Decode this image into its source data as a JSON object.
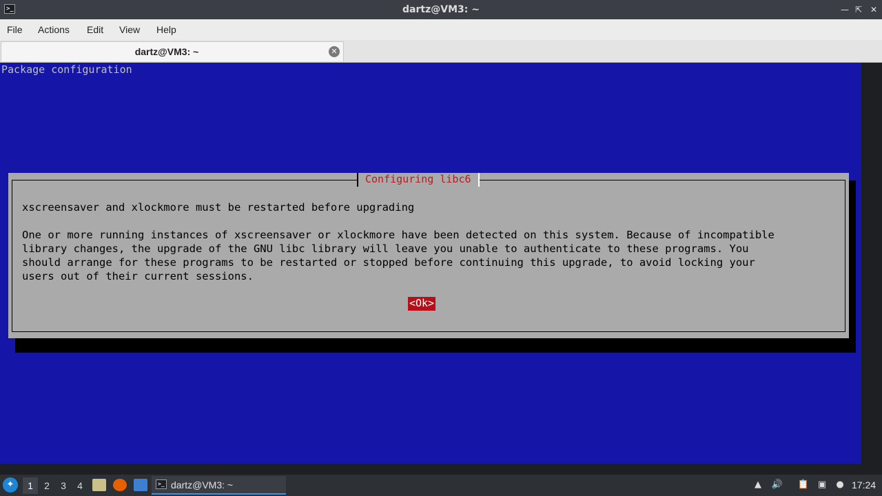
{
  "window": {
    "title": "dartz@VM3: ~",
    "app_icon": "terminal-icon",
    "controls": {
      "minimize": "minimize-icon",
      "restore": "restore-icon",
      "close": "close-icon"
    }
  },
  "menubar": {
    "items": [
      {
        "label": "File"
      },
      {
        "label": "Actions"
      },
      {
        "label": "Edit"
      },
      {
        "label": "View"
      },
      {
        "label": "Help"
      }
    ]
  },
  "tabs": [
    {
      "label": "dartz@VM3: ~",
      "active": true
    }
  ],
  "terminal": {
    "header": "Package configuration",
    "background_color": "#1515a8",
    "dialog": {
      "title": "Configuring libc6",
      "heading": "xscreensaver and xlockmore must be restarted before upgrading",
      "body_lines": [
        "One or more running instances of xscreensaver or xlockmore have been detected on this system. Because of incompatible",
        "library changes, the upgrade of the GNU libc library will leave you unable to authenticate to these programs. You",
        "should arrange for these programs to be restarted or stopped before continuing this upgrade, to avoid locking your",
        "users out of their current sessions."
      ],
      "ok_label": "<Ok>",
      "title_color": "#b02020",
      "ok_color": "#b3101a"
    }
  },
  "taskbar": {
    "start_icon": "start-menu-icon",
    "workspaces": [
      "1",
      "2",
      "3",
      "4"
    ],
    "active_workspace": "1",
    "quicklaunch": [
      "files-icon",
      "firefox-icon",
      "desktop-icon"
    ],
    "task_label": "dartz@VM3: ~",
    "tray_icons": [
      "up-arrow-icon",
      "volume-icon",
      "clipboard-icon",
      "monitor-icon",
      "update-icon"
    ],
    "clock": "17:24"
  }
}
